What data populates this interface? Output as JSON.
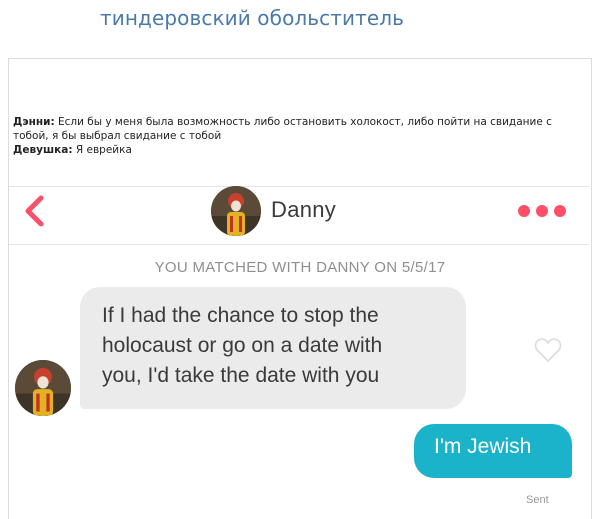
{
  "site": {
    "title": "тиндеровский обольститель"
  },
  "caption": {
    "lines": [
      {
        "speaker": "Дэнни:",
        "text": " Если бы у меня была возможность либо остановить холокост, либо пойти на свидание с тобой, я бы выбрал свидание с тобой"
      },
      {
        "speaker": "Девушка:",
        "text": " Я еврейка"
      }
    ]
  },
  "chat_header": {
    "back_icon": "chevron-left-icon",
    "name": "Danny",
    "more_icon": "more-dots-icon",
    "accent_color": "#fd5068"
  },
  "conversation": {
    "match_label": "YOU MATCHED WITH DANNY ON 5/5/17",
    "messages": [
      {
        "direction": "incoming",
        "lines": [
          "If I had the chance to stop the",
          "holocaust or go on a date with",
          "you, I'd take the date with you"
        ]
      },
      {
        "direction": "outgoing",
        "text": "I'm Jewish",
        "status": "Sent"
      }
    ],
    "like_icon": "heart-outline-icon",
    "incoming_color": "#ebebeb",
    "outgoing_color": "#1bb3c9"
  }
}
